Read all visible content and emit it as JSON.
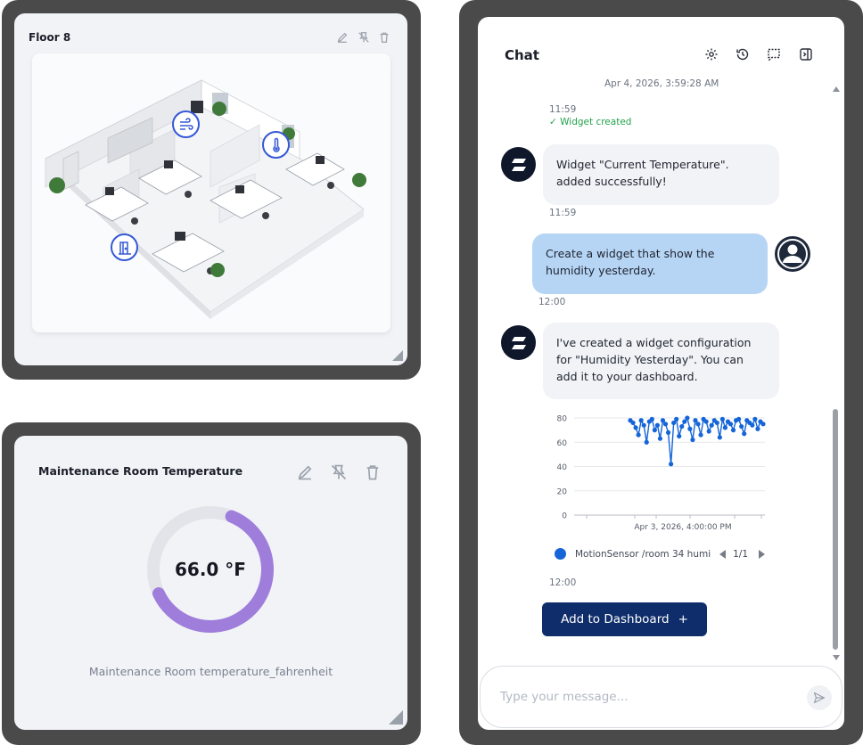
{
  "floor_widget": {
    "title": "Floor 8",
    "tools": [
      "edit-icon",
      "unpin-icon",
      "trash-icon"
    ],
    "sensors": [
      "fan-icon",
      "thermometer-icon",
      "door-icon"
    ]
  },
  "temperature_widget": {
    "title": "Maintenance Room Temperature",
    "value": "66.0 °F",
    "gauge_fraction": 0.62,
    "caption": "Maintenance Room temperature_fahrenheit",
    "accent_color": "#9f7ddb",
    "track_color": "#e3e4e9"
  },
  "chat": {
    "title": "Chat",
    "header_icons": [
      "settings-icon",
      "history-icon",
      "new-chat-icon",
      "collapse-panel-icon"
    ],
    "date_stamp": "Apr 4, 2026, 3:59:28 AM",
    "messages": [
      {
        "time": "11:59",
        "status": "✓ Widget created"
      },
      {
        "role": "bot",
        "text": "Widget \"Current Temperature\". added successfully!",
        "time": "11:59"
      },
      {
        "role": "user",
        "text": "Create a widget that show the humidity yesterday.",
        "time": "12:00"
      },
      {
        "role": "bot",
        "text": "I've created a widget configuration for \"Humidity Yesterday\". You can add it to your dashboard.",
        "time": "12:00"
      }
    ],
    "legend": {
      "label": "MotionSensor /room 34 humi",
      "pager": "1/1",
      "color": "#1565d8"
    },
    "add_button": "Add to Dashboard",
    "add_button_icon": "+",
    "input_placeholder": "Type your message..."
  },
  "chart_data": {
    "type": "line",
    "series": [
      {
        "name": "MotionSensor /room 34 humi",
        "values": [
          78,
          76,
          72,
          66,
          78,
          74,
          60,
          77,
          79,
          70,
          74,
          63,
          78,
          75,
          68,
          42,
          76,
          79,
          65,
          73,
          77,
          80,
          71,
          62,
          78,
          75,
          66,
          79,
          77,
          69,
          74,
          78,
          76,
          64,
          79,
          72,
          77,
          75,
          70,
          78,
          79,
          73,
          67,
          78,
          76,
          74,
          79,
          71,
          77,
          75
        ]
      }
    ],
    "xlabel": "",
    "ylabel": "",
    "ylim": [
      0,
      80
    ],
    "yticks": [
      0,
      20,
      40,
      60,
      80
    ],
    "xtick_label": "Apr 3, 2026, 4:00:00 PM",
    "grid": true
  }
}
